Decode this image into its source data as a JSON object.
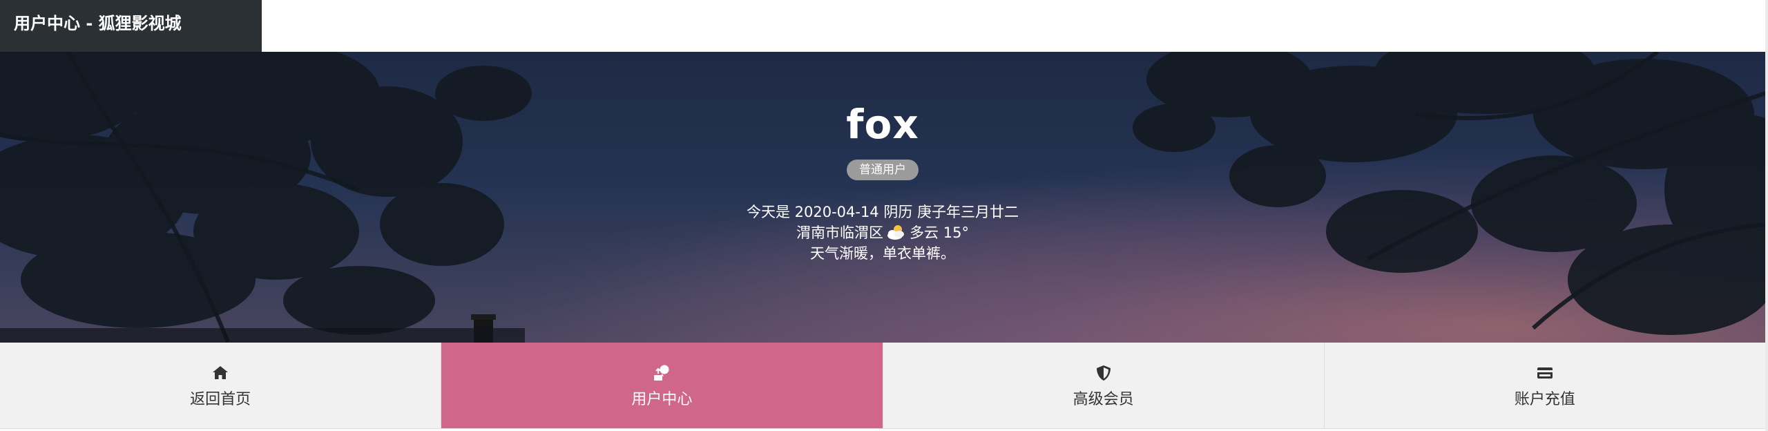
{
  "window": {
    "title": "用户中心 - 狐狸影视城"
  },
  "profile": {
    "username": "fox",
    "level_badge": "普通用户"
  },
  "greeting": {
    "date_line": "今天是 2020-04-14 阴历 庚子年三月廿二",
    "location": "渭南市临渭区",
    "weather_icon": "partly-cloudy-icon",
    "weather": "多云 15°",
    "tip": "天气渐暖，单衣单裤。"
  },
  "nav": {
    "items": [
      {
        "label": "返回首页",
        "icon": "home-icon",
        "active": false
      },
      {
        "label": "用户中心",
        "icon": "user-center-icon",
        "active": true
      },
      {
        "label": "高级会员",
        "icon": "shield-icon",
        "active": false
      },
      {
        "label": "账户充值",
        "icon": "credit-card-icon",
        "active": false
      }
    ]
  },
  "colors": {
    "brand_bar": "#2b3035",
    "active_tab": "#d0668a",
    "nav_bg": "#f1f1f1",
    "badge": "#9b9b9b"
  }
}
